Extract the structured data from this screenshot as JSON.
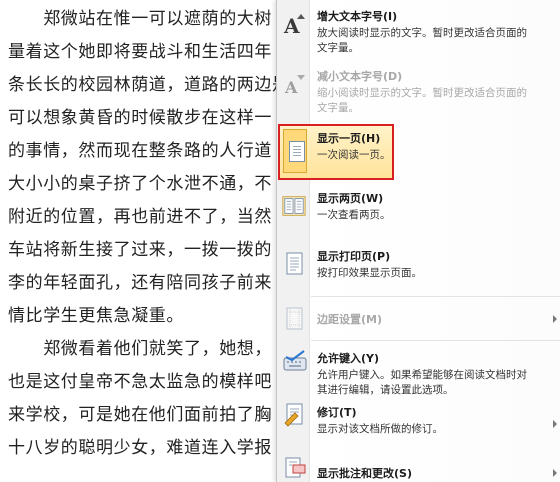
{
  "document": {
    "lines": [
      "　　郑微站在惟一可以遮荫的大树",
      "量着这个她即将要战斗和生活四年",
      "条长长的校园林荫道，道路的两边是",
      "可以想象黄昏的时候散步在这样一",
      "的事情，然而现在整条路的人行道",
      "大小小的桌子挤了个水泄不通，不",
      "附近的位置，再也前进不了，当然",
      "车站将新生接了过来，一拨一拨的",
      "李的年轻面孔，还有陪同孩子前来",
      "情比学生更焦急凝重。",
      "　　郑微看着他们就笑了，她想，",
      "也是这付皇帝不急太监急的模样吧",
      "来学校，可是她在他们面前拍了胸",
      "十八岁的聪明少女，难道连入学报"
    ]
  },
  "menu": {
    "items": [
      {
        "title": "增大文本字号(I)",
        "desc": "放大阅读时显示的文字。暂时更改适合页面的文字量。"
      },
      {
        "title": "减小文本字号(D)",
        "desc": "缩小阅读时显示的文字。暂时更改适合页面的文字量。"
      },
      {
        "title": "显示一页(H)",
        "desc": "一次阅读一页。"
      },
      {
        "title": "显示两页(W)",
        "desc": "一次查看两页。"
      },
      {
        "title": "显示打印页(P)",
        "desc": "按打印效果显示页面。"
      },
      {
        "title": "边距设置(M)",
        "desc": ""
      },
      {
        "title": "允许键入(Y)",
        "desc": "允许用户键入。如果希望能够在阅读文档时对其进行编辑，请设置此选项。"
      },
      {
        "title": "修订(T)",
        "desc": "显示对该文档所做的修订。"
      },
      {
        "title": "显示批注和更改(S)",
        "desc": ""
      }
    ]
  },
  "icons": {
    "grow_font": "font-grow-icon",
    "shrink_font": "font-shrink-icon",
    "one_page": "one-page-icon",
    "two_pages": "two-pages-icon",
    "print_page": "print-page-icon",
    "margins": "margins-icon",
    "allow_typing": "allow-typing-icon",
    "track_changes": "track-changes-icon",
    "show_comments": "show-comments-icon"
  },
  "colors": {
    "highlight_border": "#d92020",
    "highlight_fill": "#ffe39a"
  }
}
